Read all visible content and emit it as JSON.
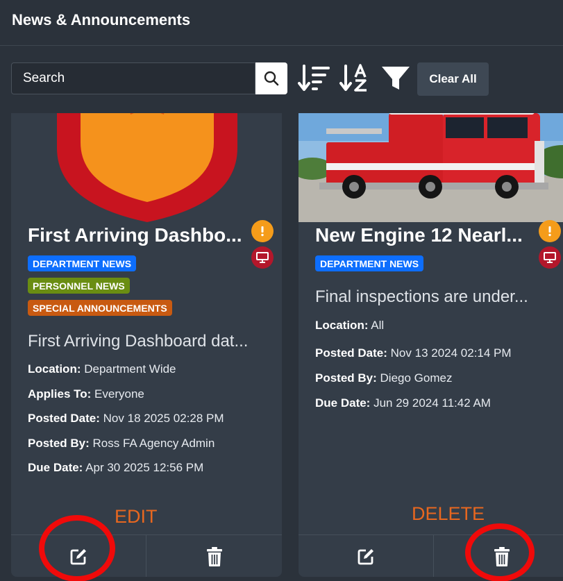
{
  "header": {
    "title": "News & Announcements"
  },
  "toolbar": {
    "search_placeholder": "Search",
    "search_icon": "search-icon",
    "sort_desc_icon": "sort-descending-icon",
    "sort_az_icon": "sort-alpha-icon",
    "filter_icon": "filter-icon",
    "clear_label": "Clear All"
  },
  "cards": [
    {
      "title": "First Arriving Dashbo...",
      "badges": [
        {
          "label": "DEPARTMENT NEWS",
          "color": "#0d6efd"
        },
        {
          "label": "PERSONNEL NEWS",
          "color": "#6a8d12"
        },
        {
          "label": "SPECIAL ANNOUNCEMENTS",
          "color": "#c85a11"
        }
      ],
      "description": "First Arriving Dashboard dat...",
      "fields": [
        {
          "label": "Location:",
          "value": "Department Wide"
        },
        {
          "label": "Applies To:",
          "value": "Everyone"
        },
        {
          "label": "Posted Date:",
          "value": "Nov 18 2025 02:28 PM"
        },
        {
          "label": "Posted By:",
          "value": "Ross FA Agency Admin"
        },
        {
          "label": "Due Date:",
          "value": "Apr 30 2025 12:56 PM"
        }
      ],
      "priority_icon": "exclamation-icon",
      "display_icon": "monitor-icon"
    },
    {
      "title": "New Engine 12 Nearl...",
      "badges": [
        {
          "label": "DEPARTMENT NEWS",
          "color": "#0d6efd"
        }
      ],
      "description": "Final inspections are under...",
      "fields": [
        {
          "label": "Location:",
          "value": "All"
        },
        {
          "label": "Posted Date:",
          "value": "Nov 13 2024 02:14 PM"
        },
        {
          "label": "Posted By:",
          "value": "Diego Gomez"
        },
        {
          "label": "Due Date:",
          "value": "Jun 29 2024 11:42 AM"
        }
      ],
      "priority_icon": "exclamation-icon",
      "display_icon": "monitor-icon"
    }
  ],
  "annotations": {
    "edit_label": "EDIT",
    "delete_label": "DELETE"
  },
  "colors": {
    "background": "#2b323b",
    "card": "#343d48",
    "warning": "#f59c1a",
    "danger": "#b3172b",
    "annotation": "#f00a0a",
    "annotation_text": "#e8671f"
  }
}
